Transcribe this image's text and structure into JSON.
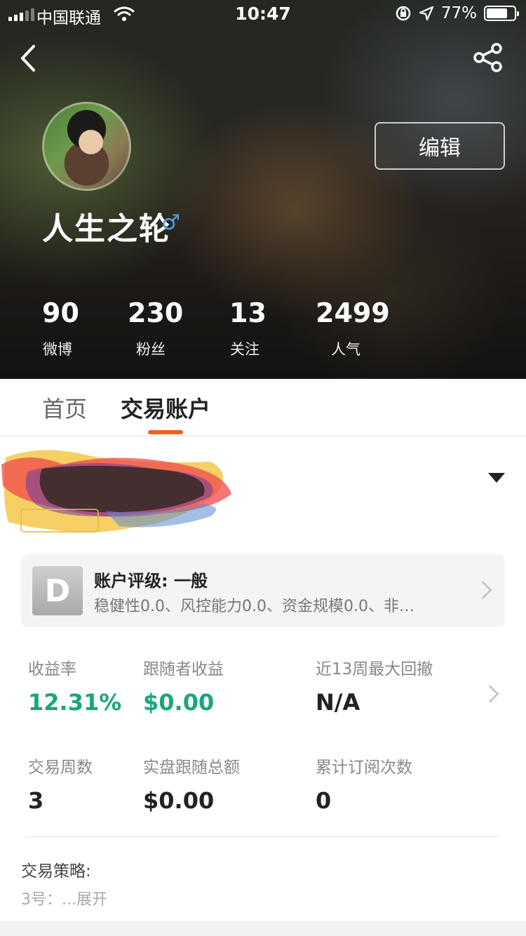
{
  "status_bar": {
    "carrier": "中国联通",
    "time": "10:47",
    "battery_percent": "77%",
    "battery_level": 0.77
  },
  "header": {
    "edit_label": "编辑",
    "username": "人生之轮",
    "gender_symbol": "♂",
    "stats": [
      {
        "value": "90",
        "label": "微博"
      },
      {
        "value": "230",
        "label": "粉丝"
      },
      {
        "value": "13",
        "label": "关注"
      },
      {
        "value": "2499",
        "label": "人气"
      }
    ]
  },
  "tabs": [
    {
      "label": "首页",
      "active": false
    },
    {
      "label": "交易账户",
      "active": true
    }
  ],
  "rating": {
    "grade": "D",
    "title": "账户评级: 一般",
    "description": "稳健性0.0、风控能力0.0、资金规模0.0、非…"
  },
  "metrics": [
    {
      "label": "收益率",
      "value": "12.31%",
      "color": "#17a77d"
    },
    {
      "label": "跟随者收益",
      "value": "$0.00",
      "color": "#17a77d"
    },
    {
      "label": "近13周最大回撤",
      "value": "N/A",
      "color": "#222222"
    },
    {
      "label": "交易周数",
      "value": "3",
      "color": "#222222"
    },
    {
      "label": "实盘跟随总额",
      "value": "$0.00",
      "color": "#222222"
    },
    {
      "label": "累计订阅次数",
      "value": "0",
      "color": "#222222"
    }
  ],
  "strategy": {
    "label": "交易策略:",
    "text": "3号：...展开"
  },
  "colors": {
    "accent": "#f2601e",
    "positive": "#17a77d",
    "gender": "#4a9ee8"
  }
}
